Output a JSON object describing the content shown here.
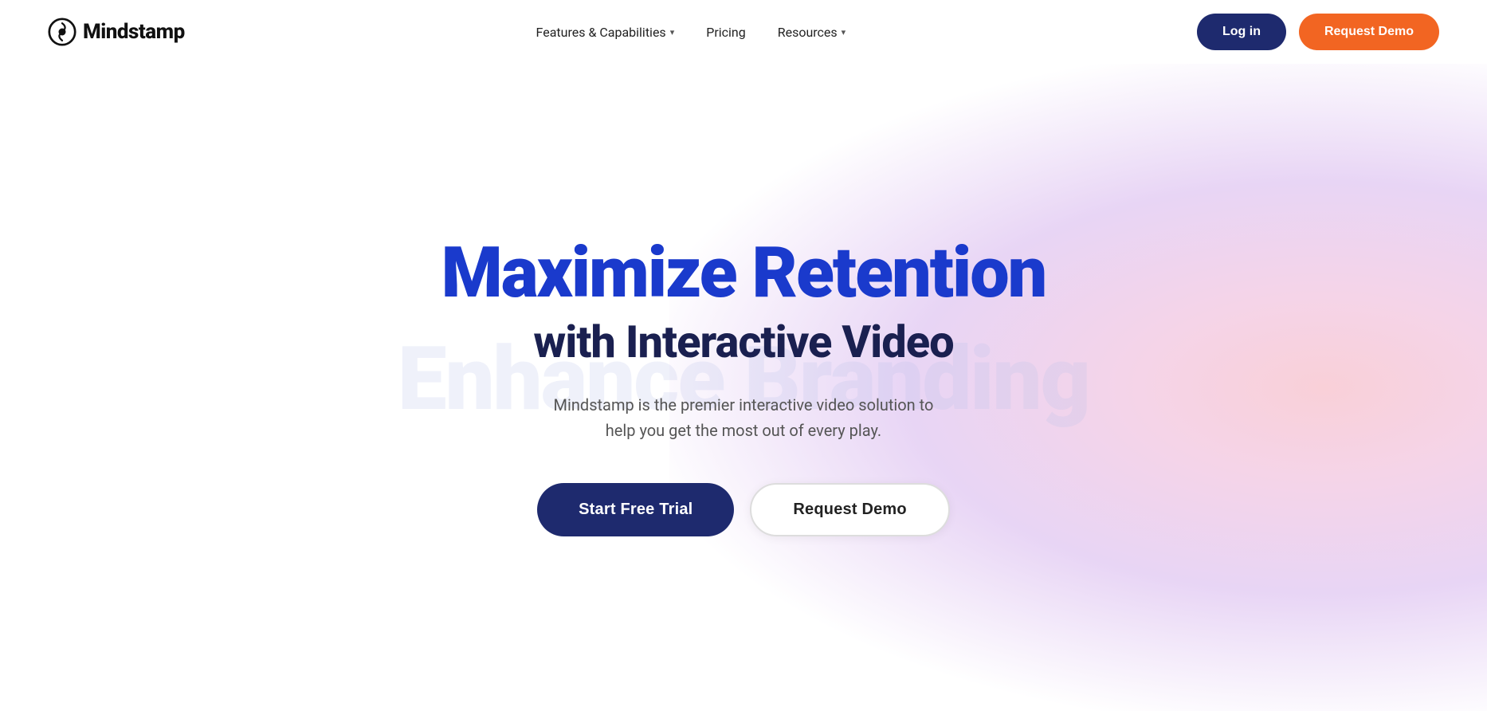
{
  "brand": {
    "name": "Mindstamp",
    "logo_alt": "Mindstamp logo"
  },
  "nav": {
    "features_label": "Features & Capabilities",
    "features_chevron": "▾",
    "pricing_label": "Pricing",
    "resources_label": "Resources",
    "resources_chevron": "▾",
    "login_label": "Log in",
    "request_demo_label": "Request Demo"
  },
  "hero": {
    "ghost_text": "Enhance Branding",
    "headline": "Maximize Retention",
    "subheadline": "with Interactive Video",
    "description": "Mindstamp is the premier interactive video solution to\nhelp you get the most out of every play.",
    "cta_primary": "Start Free Trial",
    "cta_secondary": "Request Demo"
  }
}
